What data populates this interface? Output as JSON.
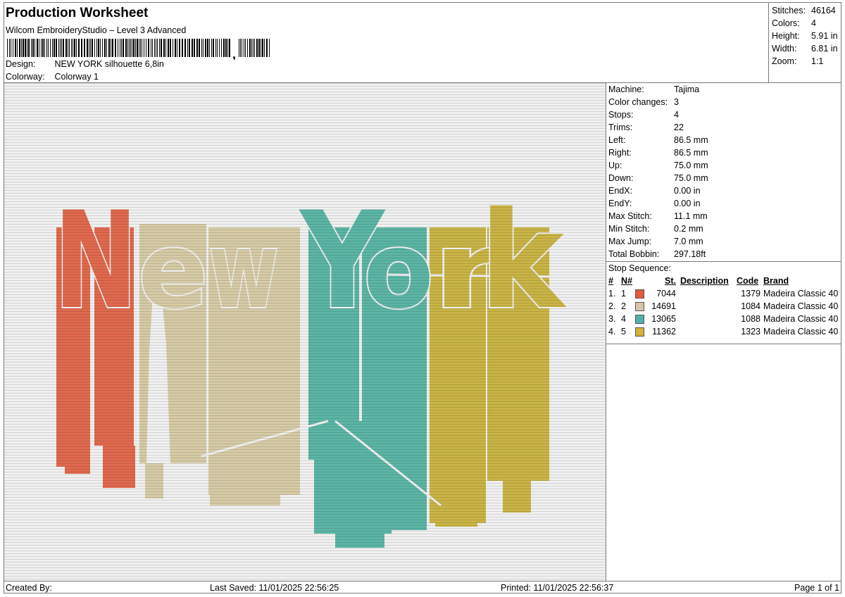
{
  "header": {
    "title": "Production Worksheet",
    "software": "Wilcom EmbroideryStudio – Level 3 Advanced",
    "design_label": "Design:",
    "design_value": "NEW YORK silhouette 6,8in",
    "colorway_label": "Colorway:",
    "colorway_value": "Colorway 1"
  },
  "stats": [
    {
      "label": "Stitches:",
      "value": "46164"
    },
    {
      "label": "Colors:",
      "value": "4"
    },
    {
      "label": "Height:",
      "value": "5.91 in"
    },
    {
      "label": "Width:",
      "value": "6.81 in"
    },
    {
      "label": "Zoom:",
      "value": "1:1"
    }
  ],
  "params": [
    {
      "label": "Machine:",
      "value": "Tajima"
    },
    {
      "label": "Color changes:",
      "value": "3"
    },
    {
      "label": "Stops:",
      "value": "4"
    },
    {
      "label": "Trims:",
      "value": "22"
    },
    {
      "label": "Left:",
      "value": "86.5 mm"
    },
    {
      "label": "Right:",
      "value": "86.5 mm"
    },
    {
      "label": "Up:",
      "value": "75.0 mm"
    },
    {
      "label": "Down:",
      "value": "75.0 mm"
    },
    {
      "label": "EndX:",
      "value": "0.00 in"
    },
    {
      "label": "EndY:",
      "value": "0.00 in"
    },
    {
      "label": "Max Stitch:",
      "value": "11.1 mm"
    },
    {
      "label": "Min Stitch:",
      "value": "0.2 mm"
    },
    {
      "label": "Max Jump:",
      "value": "7.0 mm"
    },
    {
      "label": "Total Bobbin:",
      "value": "297.18ft"
    }
  ],
  "stop_sequence": {
    "title": "Stop Sequence:",
    "headers": {
      "hash": "#",
      "n": "N#",
      "st": "St.",
      "description": "Description",
      "code": "Code",
      "brand": "Brand"
    },
    "rows": [
      {
        "idx": "1.",
        "n": "1",
        "color": "#e55a3f",
        "st": "7044",
        "description": "",
        "code": "1379",
        "brand": "Madeira Classic 40"
      },
      {
        "idx": "2.",
        "n": "2",
        "color": "#d8c4a8",
        "st": "14691",
        "description": "",
        "code": "1084",
        "brand": "Madeira Classic 40"
      },
      {
        "idx": "3.",
        "n": "4",
        "color": "#4fb2a8",
        "st": "13065",
        "description": "",
        "code": "1088",
        "brand": "Madeira Classic 40"
      },
      {
        "idx": "4.",
        "n": "5",
        "color": "#d4b33a",
        "st": "11362",
        "description": "",
        "code": "1323",
        "brand": "Madeira Classic 40"
      }
    ]
  },
  "design": {
    "letters": [
      "N",
      "e",
      "w",
      "Y",
      "o",
      "r",
      "k"
    ],
    "letter_colors": [
      "#e0694e",
      "#d6cba6",
      "#d6cba6",
      "#5cb5a5",
      "#5cb5a5",
      "#c9b446",
      "#c9b446"
    ],
    "bg_color": "#f0f0f0"
  },
  "footer": {
    "created_by": "Created By:",
    "last_saved": "Last Saved: 11/01/2025 22:56:25",
    "printed": "Printed: 11/01/2025 22:56:37",
    "page": "Page 1 of 1"
  }
}
